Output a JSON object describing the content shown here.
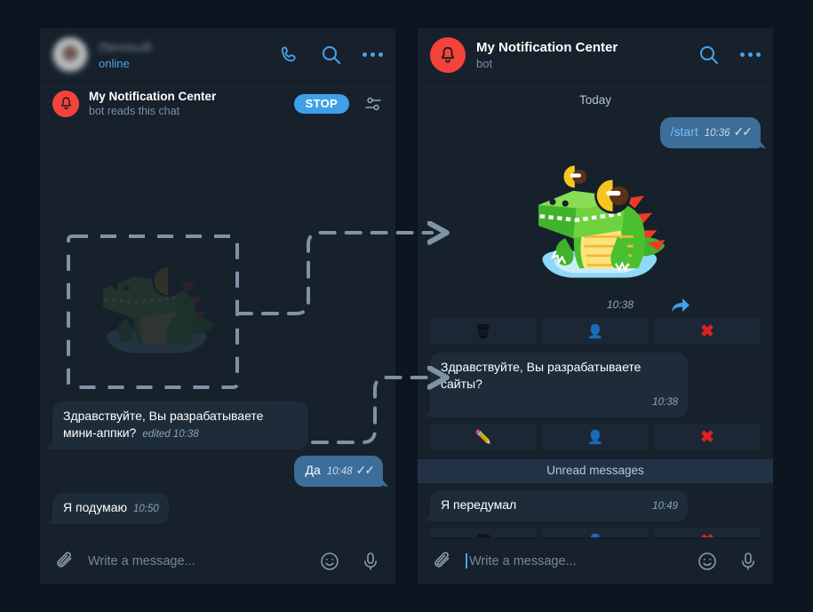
{
  "theme": {
    "page_bg": "#0d1520",
    "panel_bg": "#17212b",
    "bubble_in": "#1e2c3a",
    "bubble_out": "#3d6d99",
    "accent_blue": "#3fa0e8",
    "bell_red": "#f4433c",
    "danger_red": "#e02020",
    "unread_bar": "#223244"
  },
  "left_panel": {
    "header": {
      "avatar_icon": "user-avatar-blurred",
      "name": "Личный",
      "name_blurred": true,
      "status": "online",
      "actions": [
        {
          "icon": "phone-icon",
          "name": "call-button"
        },
        {
          "icon": "search-icon",
          "name": "search-button"
        },
        {
          "icon": "more-icon",
          "name": "more-button"
        }
      ]
    },
    "bot_bar": {
      "avatar_icon": "bell-icon",
      "title": "My Notification Center",
      "subtitle": "bot reads this chat",
      "stop_label": "STOP",
      "settings_icon": "sliders-icon"
    },
    "messages": [
      {
        "id": "msg-mini-apps",
        "direction": "in",
        "text": "Здравствуйте, Вы разрабатываете мини-аппки?",
        "meta": "edited 10:38",
        "ticks": ""
      },
      {
        "id": "msg-da",
        "direction": "out",
        "text": "Да",
        "meta": "10:48",
        "ticks": "✓✓"
      },
      {
        "id": "msg-podumayu",
        "direction": "in",
        "text": "Я подумаю",
        "meta": "10:50",
        "ticks": ""
      }
    ],
    "composer": {
      "attach_icon": "paperclip-icon",
      "placeholder": "Write a message...",
      "show_caret": false,
      "emoji_icon": "smiley-icon",
      "mic_icon": "microphone-icon"
    }
  },
  "right_panel": {
    "header": {
      "avatar_icon": "bell-icon",
      "name": "My Notification Center",
      "status": "bot",
      "actions": [
        {
          "icon": "search-icon",
          "name": "search-button"
        },
        {
          "icon": "more-icon",
          "name": "more-button"
        }
      ]
    },
    "day_divider": "Today",
    "unread_divider": "Unread messages",
    "messages": [
      {
        "id": "msg-start",
        "type": "text",
        "direction": "out",
        "command": "/start",
        "meta": "10:36",
        "ticks": "✓✓"
      },
      {
        "id": "msg-sticker",
        "type": "sticker",
        "sticker_name": "crocodile-sticker",
        "meta": "10:38",
        "forward_icon": "forward-arrow-icon",
        "keyboard": [
          {
            "label": "🗑",
            "name": "kb-delete-button"
          },
          {
            "label": "👤",
            "name": "kb-user-button"
          },
          {
            "label": "✖",
            "name": "kb-block-button"
          }
        ]
      },
      {
        "id": "msg-sites",
        "type": "text",
        "direction": "in",
        "text": "Здравствуйте, Вы разрабатываете сайты?",
        "meta": "10:38",
        "keyboard": [
          {
            "label": "✏️",
            "name": "kb-edit-button"
          },
          {
            "label": "👤",
            "name": "kb-user-button"
          },
          {
            "label": "✖",
            "name": "kb-block-button"
          }
        ]
      },
      {
        "id": "msg-peredumal",
        "type": "text",
        "direction": "in",
        "text": "Я передумал",
        "meta": "10:49",
        "keyboard": [
          {
            "label": "🗑",
            "name": "kb-delete-button"
          },
          {
            "label": "👤",
            "name": "kb-user-button"
          },
          {
            "label": "✖",
            "name": "kb-block-button"
          }
        ]
      }
    ],
    "composer": {
      "attach_icon": "paperclip-icon",
      "placeholder": "Write a message...",
      "show_caret": true,
      "emoji_icon": "smiley-icon",
      "mic_icon": "microphone-icon"
    }
  },
  "annotations": {
    "ghost_box_label": "dashed-outline-around-sticker",
    "arrow_top_label": "dashed-arrow-to-sticker",
    "arrow_bottom_label": "dashed-arrow-to-message"
  }
}
